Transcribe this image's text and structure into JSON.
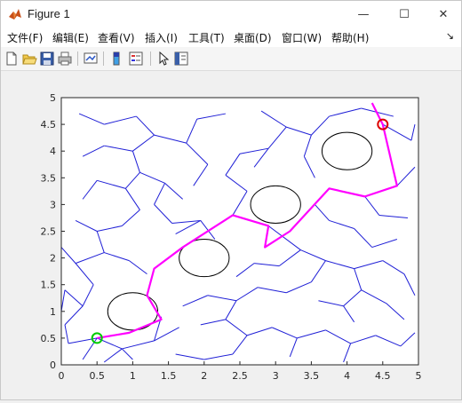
{
  "window": {
    "title": "Figure 1",
    "controls": {
      "minimize": "—",
      "maximize": "☐",
      "close": "✕"
    }
  },
  "menu": {
    "items": [
      "文件(F)",
      "编辑(E)",
      "查看(V)",
      "插入(I)",
      "工具(T)",
      "桌面(D)",
      "窗口(W)",
      "帮助(H)"
    ],
    "overflow_arrow": "↘"
  },
  "toolbar": {
    "buttons": [
      "new-figure-icon",
      "open-folder-icon",
      "save-icon",
      "print-icon",
      "link-plot-icon",
      "colorbar-icon",
      "legend-icon",
      "edit-pointer-icon",
      "property-inspector-icon"
    ]
  },
  "colors": {
    "tree": "#1f1fd6",
    "path": "#ff00ff",
    "start": "#00cc00",
    "goal": "#dd0000",
    "obstacle": "#000000"
  },
  "chart_data": {
    "type": "line",
    "title": "",
    "xlabel": "",
    "ylabel": "",
    "xlim": [
      0,
      5
    ],
    "ylim": [
      0,
      5
    ],
    "xticks": [
      "0",
      "0.5",
      "1",
      "1.5",
      "2",
      "2.5",
      "3",
      "3.5",
      "4",
      "4.5",
      "5"
    ],
    "yticks": [
      "0",
      "0.5",
      "1",
      "1.5",
      "2",
      "2.5",
      "3",
      "3.5",
      "4",
      "4.5",
      "5"
    ],
    "grid": false,
    "start": [
      0.5,
      0.5
    ],
    "goal": [
      4.5,
      4.5
    ],
    "obstacles": [
      {
        "cx": 1.0,
        "cy": 1.0,
        "r": 0.35
      },
      {
        "cx": 2.0,
        "cy": 2.0,
        "r": 0.35
      },
      {
        "cx": 3.0,
        "cy": 3.0,
        "r": 0.35
      },
      {
        "cx": 4.0,
        "cy": 4.0,
        "r": 0.35
      }
    ],
    "path": [
      [
        0.5,
        0.5
      ],
      [
        0.95,
        0.6
      ],
      [
        1.4,
        0.85
      ],
      [
        1.2,
        1.3
      ],
      [
        1.3,
        1.8
      ],
      [
        1.7,
        2.2
      ],
      [
        2.4,
        2.8
      ],
      [
        2.9,
        2.6
      ],
      [
        2.85,
        2.2
      ],
      [
        3.2,
        2.5
      ],
      [
        3.75,
        3.3
      ],
      [
        4.25,
        3.15
      ],
      [
        4.7,
        3.35
      ],
      [
        4.5,
        4.5
      ],
      [
        4.35,
        4.9
      ]
    ],
    "tree_edges": [
      [
        [
          0.5,
          0.5
        ],
        [
          0.1,
          0.4
        ]
      ],
      [
        [
          0.5,
          0.5
        ],
        [
          0.3,
          0.1
        ]
      ],
      [
        [
          0.5,
          0.5
        ],
        [
          0.85,
          0.3
        ]
      ],
      [
        [
          0.85,
          0.3
        ],
        [
          1.3,
          0.45
        ]
      ],
      [
        [
          1.3,
          0.45
        ],
        [
          1.4,
          0.9
        ]
      ],
      [
        [
          1.3,
          0.45
        ],
        [
          1.65,
          0.7
        ]
      ],
      [
        [
          0.85,
          0.3
        ],
        [
          0.6,
          0.05
        ]
      ],
      [
        [
          0.85,
          0.3
        ],
        [
          1.0,
          0.1
        ]
      ],
      [
        [
          0.1,
          0.4
        ],
        [
          0.05,
          0.75
        ]
      ],
      [
        [
          0.05,
          0.75
        ],
        [
          0.3,
          1.1
        ]
      ],
      [
        [
          0.3,
          1.1
        ],
        [
          0.05,
          1.4
        ]
      ],
      [
        [
          0.3,
          1.1
        ],
        [
          0.45,
          1.5
        ]
      ],
      [
        [
          0.45,
          1.5
        ],
        [
          0.2,
          1.9
        ]
      ],
      [
        [
          0.2,
          1.9
        ],
        [
          0.0,
          2.2
        ]
      ],
      [
        [
          0.2,
          1.9
        ],
        [
          0.6,
          2.1
        ]
      ],
      [
        [
          0.6,
          2.1
        ],
        [
          0.95,
          1.95
        ]
      ],
      [
        [
          0.95,
          1.95
        ],
        [
          1.2,
          1.7
        ]
      ],
      [
        [
          0.6,
          2.1
        ],
        [
          0.5,
          2.5
        ]
      ],
      [
        [
          0.5,
          2.5
        ],
        [
          0.2,
          2.7
        ]
      ],
      [
        [
          0.5,
          2.5
        ],
        [
          0.85,
          2.6
        ]
      ],
      [
        [
          0.85,
          2.6
        ],
        [
          1.1,
          2.9
        ]
      ],
      [
        [
          1.1,
          2.9
        ],
        [
          0.9,
          3.3
        ]
      ],
      [
        [
          0.9,
          3.3
        ],
        [
          0.5,
          3.45
        ]
      ],
      [
        [
          0.5,
          3.45
        ],
        [
          0.3,
          3.1
        ]
      ],
      [
        [
          0.9,
          3.3
        ],
        [
          1.1,
          3.6
        ]
      ],
      [
        [
          1.1,
          3.6
        ],
        [
          1.45,
          3.4
        ]
      ],
      [
        [
          1.45,
          3.4
        ],
        [
          1.7,
          3.1
        ]
      ],
      [
        [
          1.1,
          3.6
        ],
        [
          1.0,
          4.0
        ]
      ],
      [
        [
          1.0,
          4.0
        ],
        [
          0.6,
          4.1
        ]
      ],
      [
        [
          0.6,
          4.1
        ],
        [
          0.3,
          3.9
        ]
      ],
      [
        [
          1.0,
          4.0
        ],
        [
          1.3,
          4.3
        ]
      ],
      [
        [
          1.3,
          4.3
        ],
        [
          1.05,
          4.65
        ]
      ],
      [
        [
          1.05,
          4.65
        ],
        [
          0.6,
          4.5
        ]
      ],
      [
        [
          0.6,
          4.5
        ],
        [
          0.25,
          4.7
        ]
      ],
      [
        [
          1.3,
          4.3
        ],
        [
          1.75,
          4.15
        ]
      ],
      [
        [
          1.75,
          4.15
        ],
        [
          1.9,
          4.6
        ]
      ],
      [
        [
          1.9,
          4.6
        ],
        [
          2.3,
          4.7
        ]
      ],
      [
        [
          1.75,
          4.15
        ],
        [
          2.05,
          3.75
        ]
      ],
      [
        [
          2.05,
          3.75
        ],
        [
          1.85,
          3.35
        ]
      ],
      [
        [
          1.45,
          3.4
        ],
        [
          1.3,
          3.0
        ]
      ],
      [
        [
          1.3,
          3.0
        ],
        [
          1.55,
          2.65
        ]
      ],
      [
        [
          1.55,
          2.65
        ],
        [
          1.95,
          2.7
        ]
      ],
      [
        [
          1.95,
          2.7
        ],
        [
          2.15,
          2.35
        ]
      ],
      [
        [
          2.4,
          2.8
        ],
        [
          2.6,
          3.25
        ]
      ],
      [
        [
          2.6,
          3.25
        ],
        [
          2.3,
          3.55
        ]
      ],
      [
        [
          2.3,
          3.55
        ],
        [
          2.5,
          3.95
        ]
      ],
      [
        [
          2.5,
          3.95
        ],
        [
          2.9,
          4.05
        ]
      ],
      [
        [
          2.9,
          4.05
        ],
        [
          3.15,
          4.45
        ]
      ],
      [
        [
          3.15,
          4.45
        ],
        [
          2.8,
          4.75
        ]
      ],
      [
        [
          3.15,
          4.45
        ],
        [
          3.5,
          4.3
        ]
      ],
      [
        [
          3.5,
          4.3
        ],
        [
          3.75,
          4.65
        ]
      ],
      [
        [
          3.75,
          4.65
        ],
        [
          4.2,
          4.8
        ]
      ],
      [
        [
          4.2,
          4.8
        ],
        [
          4.65,
          4.65
        ]
      ],
      [
        [
          3.5,
          4.3
        ],
        [
          3.4,
          3.9
        ]
      ],
      [
        [
          3.4,
          3.9
        ],
        [
          3.55,
          3.5
        ]
      ],
      [
        [
          2.9,
          4.05
        ],
        [
          2.7,
          3.7
        ]
      ],
      [
        [
          3.75,
          3.3
        ],
        [
          3.55,
          3.0
        ]
      ],
      [
        [
          3.55,
          3.0
        ],
        [
          3.75,
          2.7
        ]
      ],
      [
        [
          3.75,
          2.7
        ],
        [
          4.1,
          2.55
        ]
      ],
      [
        [
          4.1,
          2.55
        ],
        [
          4.35,
          2.2
        ]
      ],
      [
        [
          4.35,
          2.2
        ],
        [
          4.7,
          2.35
        ]
      ],
      [
        [
          4.25,
          3.15
        ],
        [
          4.45,
          2.8
        ]
      ],
      [
        [
          4.45,
          2.8
        ],
        [
          4.85,
          2.75
        ]
      ],
      [
        [
          4.7,
          3.35
        ],
        [
          4.95,
          3.7
        ]
      ],
      [
        [
          4.5,
          4.5
        ],
        [
          4.9,
          4.2
        ]
      ],
      [
        [
          4.9,
          4.2
        ],
        [
          4.95,
          4.5
        ]
      ],
      [
        [
          2.9,
          2.6
        ],
        [
          3.35,
          2.15
        ]
      ],
      [
        [
          3.35,
          2.15
        ],
        [
          3.7,
          1.95
        ]
      ],
      [
        [
          3.7,
          1.95
        ],
        [
          3.5,
          1.55
        ]
      ],
      [
        [
          3.5,
          1.55
        ],
        [
          3.15,
          1.35
        ]
      ],
      [
        [
          3.15,
          1.35
        ],
        [
          2.75,
          1.45
        ]
      ],
      [
        [
          2.75,
          1.45
        ],
        [
          2.45,
          1.2
        ]
      ],
      [
        [
          2.45,
          1.2
        ],
        [
          2.05,
          1.3
        ]
      ],
      [
        [
          2.05,
          1.3
        ],
        [
          1.7,
          1.1
        ]
      ],
      [
        [
          2.45,
          1.2
        ],
        [
          2.3,
          0.85
        ]
      ],
      [
        [
          2.3,
          0.85
        ],
        [
          1.95,
          0.75
        ]
      ],
      [
        [
          2.3,
          0.85
        ],
        [
          2.6,
          0.55
        ]
      ],
      [
        [
          2.6,
          0.55
        ],
        [
          2.95,
          0.7
        ]
      ],
      [
        [
          2.95,
          0.7
        ],
        [
          3.3,
          0.5
        ]
      ],
      [
        [
          3.3,
          0.5
        ],
        [
          3.7,
          0.65
        ]
      ],
      [
        [
          3.7,
          0.65
        ],
        [
          4.05,
          0.4
        ]
      ],
      [
        [
          4.05,
          0.4
        ],
        [
          4.4,
          0.55
        ]
      ],
      [
        [
          4.4,
          0.55
        ],
        [
          4.75,
          0.35
        ]
      ],
      [
        [
          4.75,
          0.35
        ],
        [
          4.95,
          0.6
        ]
      ],
      [
        [
          4.05,
          0.4
        ],
        [
          3.95,
          0.05
        ]
      ],
      [
        [
          3.3,
          0.5
        ],
        [
          3.2,
          0.15
        ]
      ],
      [
        [
          2.6,
          0.55
        ],
        [
          2.4,
          0.2
        ]
      ],
      [
        [
          2.4,
          0.2
        ],
        [
          2.0,
          0.1
        ]
      ],
      [
        [
          2.0,
          0.1
        ],
        [
          1.6,
          0.2
        ]
      ],
      [
        [
          3.7,
          1.95
        ],
        [
          4.1,
          1.8
        ]
      ],
      [
        [
          4.1,
          1.8
        ],
        [
          4.5,
          1.95
        ]
      ],
      [
        [
          4.5,
          1.95
        ],
        [
          4.8,
          1.7
        ]
      ],
      [
        [
          4.8,
          1.7
        ],
        [
          4.95,
          1.3
        ]
      ],
      [
        [
          4.1,
          1.8
        ],
        [
          4.2,
          1.4
        ]
      ],
      [
        [
          4.2,
          1.4
        ],
        [
          3.95,
          1.1
        ]
      ],
      [
        [
          3.95,
          1.1
        ],
        [
          3.6,
          1.2
        ]
      ],
      [
        [
          4.2,
          1.4
        ],
        [
          4.55,
          1.15
        ]
      ],
      [
        [
          4.55,
          1.15
        ],
        [
          4.8,
          0.85
        ]
      ],
      [
        [
          3.95,
          1.1
        ],
        [
          4.1,
          0.8
        ]
      ],
      [
        [
          1.95,
          2.7
        ],
        [
          1.6,
          2.45
        ]
      ],
      [
        [
          3.35,
          2.15
        ],
        [
          3.05,
          1.85
        ]
      ],
      [
        [
          3.05,
          1.85
        ],
        [
          2.7,
          1.9
        ]
      ],
      [
        [
          2.7,
          1.9
        ],
        [
          2.45,
          1.65
        ]
      ],
      [
        [
          0.05,
          1.4
        ],
        [
          0.0,
          1.0
        ]
      ]
    ]
  }
}
